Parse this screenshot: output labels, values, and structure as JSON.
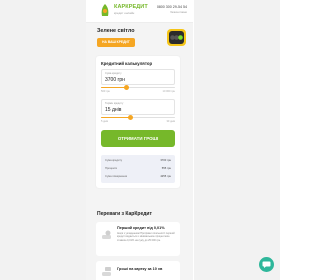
{
  "header": {
    "logo_title": "КАРКРЕДИТ",
    "logo_subtitle": "кредит онлайн",
    "phone": "0800 300 29-54 54",
    "phone_hours": "безкоштовно"
  },
  "hero": {
    "title": "Зелене світло",
    "button_label": "НА ВАШ КРЕДИТ"
  },
  "calculator": {
    "title": "Кредитний калькулятор",
    "amount": {
      "label": "Сума кредиту",
      "value": "3700 грн",
      "min": "500 грн",
      "max": "10 000 грн",
      "fraction": 0.34
    },
    "term": {
      "label": "Термін кредиту",
      "value": "15 днів",
      "min": "5 днів",
      "max": "30 днів",
      "fraction": 0.4
    },
    "submit_label": "ОТРИМАТИ ГРОШІ",
    "summary": [
      {
        "label": "Сума кредиту",
        "value": "3700 грн"
      },
      {
        "label": "Проценти",
        "value": "555 грн"
      },
      {
        "label": "Сума повернення",
        "value": "4255 грн"
      }
    ]
  },
  "advantages": {
    "title": "Переваги з КарКредит",
    "items": [
      {
        "title": "Перший кредит під 0,01%",
        "text": "Акція з укладенням Програми лояльності перший кредит видається з мінімальною процентною ставкою 0,01% на суму до 25 000 грн."
      },
      {
        "title": "Гроші на картку за 10 хв",
        "text": ""
      }
    ]
  },
  "colors": {
    "brand_green": "#76b82a",
    "accent_orange": "#f5a623",
    "chat_teal": "#2fb79b"
  },
  "icons": {
    "logo": "car-logo-icon",
    "hero": "traffic-light-icon",
    "card1": "hand-coin-icon",
    "card2": "hand-card-icon",
    "chat": "chat-icon"
  }
}
